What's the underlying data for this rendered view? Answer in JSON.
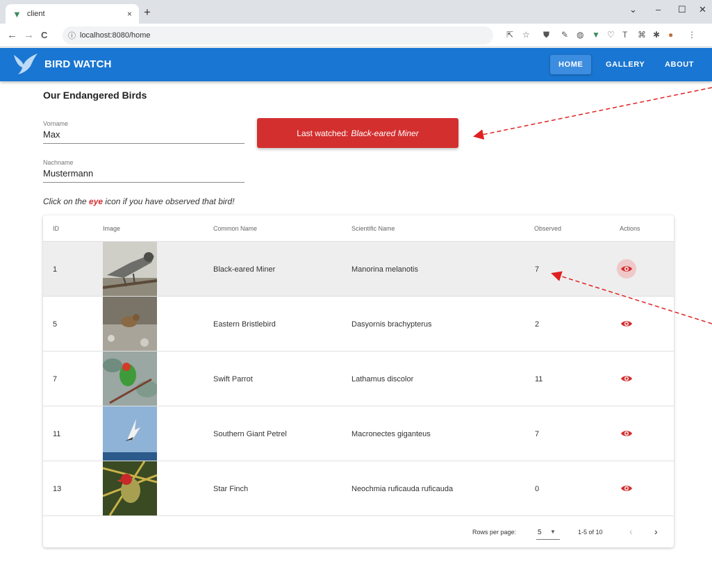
{
  "browser": {
    "tab_title": "client",
    "tab_close": "×",
    "new_tab": "+",
    "url": "localhost:8080/home",
    "info_icon": "ⓘ",
    "back": "←",
    "forward": "→",
    "reload": "C",
    "window_controls": {
      "dropdown": "⌄",
      "minimize": "–",
      "maximize": "☐",
      "close": "✕"
    }
  },
  "app": {
    "title": "BIRD WATCH",
    "nav": [
      {
        "label": "HOME"
      },
      {
        "label": "GALLERY"
      },
      {
        "label": "ABOUT"
      }
    ]
  },
  "main": {
    "heading": "Our Endangered Birds",
    "vorname": {
      "label": "Vorname",
      "value": "Max"
    },
    "nachname": {
      "label": "Nachname",
      "value": "Mustermann"
    },
    "last_watched": {
      "prefix": "Last watched:",
      "bird": "Black-eared Miner"
    },
    "hint": {
      "before": "Click on the",
      "eye_word": "eye",
      "after": "icon if you have observed that bird!"
    }
  },
  "table": {
    "headers": {
      "id": "ID",
      "image": "Image",
      "common": "Common Name",
      "scientific": "Scientific Name",
      "observed": "Observed",
      "actions": "Actions"
    },
    "rows": [
      {
        "id": "1",
        "common": "Black-eared Miner",
        "scientific": "Manorina melanotis",
        "observed": "7"
      },
      {
        "id": "5",
        "common": "Eastern Bristlebird",
        "scientific": "Dasyornis brachypterus",
        "observed": "2"
      },
      {
        "id": "7",
        "common": "Swift Parrot",
        "scientific": "Lathamus discolor",
        "observed": "11"
      },
      {
        "id": "11",
        "common": "Southern Giant Petrel",
        "scientific": "Macronectes giganteus",
        "observed": "7"
      },
      {
        "id": "13",
        "common": "Star Finch",
        "scientific": "Neochmia ruficauda ruficauda",
        "observed": "0"
      }
    ],
    "footer": {
      "rows_per_page_label": "Rows per page:",
      "rows_per_page": "5",
      "range": "1-5 of 10",
      "prev": "‹",
      "next": "›"
    }
  },
  "colors": {
    "appbar": "#1976d2",
    "accent_red": "#d32f2f",
    "row_highlight": "#eeeeee"
  }
}
